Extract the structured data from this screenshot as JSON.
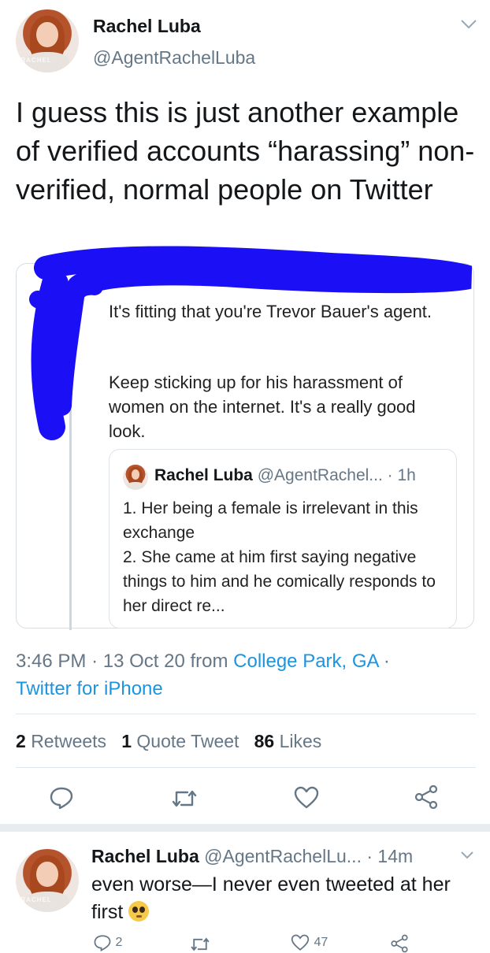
{
  "tweet": {
    "author_name": "Rachel Luba",
    "author_handle": "@AgentRachelLuba",
    "text": "I guess this is just another example of verified accounts “harassing” non-verified, normal people on Twitter",
    "quoted": {
      "text_line1": "It's fitting that you're Trevor Bauer's agent.",
      "text_line2": "Keep sticking up for his harassment of women on the internet. It's a really good look.",
      "nested": {
        "author_name": "Rachel Luba",
        "author_handle": "@AgentRachel...",
        "time": "· 1h",
        "text": "1. Her being a female is irrelevant in this exchange\n2. She came at him first saying negative things to him and he comically responds to her direct re..."
      }
    },
    "meta": {
      "time": "3:46 PM",
      "sep1": "·",
      "date": "13 Oct 20",
      "from_word": "from",
      "location": "College Park, GA",
      "sep2": "·",
      "source": "Twitter for iPhone"
    },
    "stats": {
      "retweets_count": "2",
      "retweets_label": "Retweets",
      "quotes_count": "1",
      "quotes_label": "Quote Tweet",
      "likes_count": "86",
      "likes_label": "Likes"
    }
  },
  "reply": {
    "author_name": "Rachel Luba",
    "author_handle": "@AgentRachelLu...",
    "time": "· 14m",
    "text": "even worse—I never even tweeted at her first",
    "emoji": "🥺",
    "reply_count": "2",
    "like_count": "47"
  },
  "colors": {
    "accent": "#1b95e0",
    "text": "#14171a",
    "muted": "#657786",
    "redaction": "#1a0ff5",
    "divider": "#e1e8ed"
  },
  "icons": [
    "chevron-down-icon",
    "reply-icon",
    "retweet-icon",
    "like-icon",
    "share-icon",
    "pleading-face-emoji"
  ]
}
